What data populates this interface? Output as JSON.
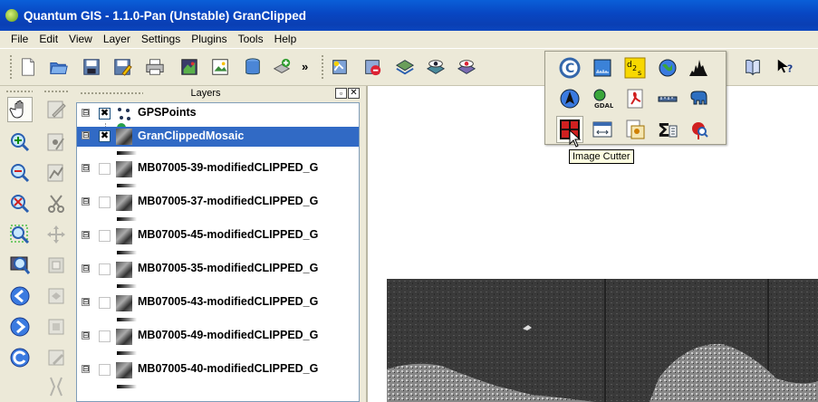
{
  "window": {
    "title": "Quantum GIS - 1.1.0-Pan (Unstable) GranClipped"
  },
  "menu": [
    "File",
    "Edit",
    "View",
    "Layer",
    "Settings",
    "Plugins",
    "Tools",
    "Help"
  ],
  "toolbar": {
    "overflow_label": "»"
  },
  "layers_panel": {
    "title": "Layers",
    "float_label": "▫",
    "close_label": "✕",
    "layers": [
      {
        "name": "GPSPoints",
        "checked": true,
        "check_mark": "✖",
        "expander": "⊟",
        "selected": false
      },
      {
        "name": "GranClippedMosaic",
        "checked": true,
        "check_mark": "✖",
        "expander": "⊟",
        "selected": true
      },
      {
        "name": "MB07005-39-modifiedCLIPPED_G",
        "checked": false,
        "check_mark": "",
        "expander": "⊟",
        "selected": false
      },
      {
        "name": "MB07005-37-modifiedCLIPPED_G",
        "checked": false,
        "check_mark": "",
        "expander": "⊟",
        "selected": false
      },
      {
        "name": "MB07005-45-modifiedCLIPPED_G",
        "checked": false,
        "check_mark": "",
        "expander": "⊟",
        "selected": false
      },
      {
        "name": "MB07005-35-modifiedCLIPPED_G",
        "checked": false,
        "check_mark": "",
        "expander": "⊟",
        "selected": false
      },
      {
        "name": "MB07005-43-modifiedCLIPPED_G",
        "checked": false,
        "check_mark": "",
        "expander": "⊟",
        "selected": false
      },
      {
        "name": "MB07005-49-modifiedCLIPPED_G",
        "checked": false,
        "check_mark": "",
        "expander": "⊟",
        "selected": false
      },
      {
        "name": "MB07005-40-modifiedCLIPPED_G",
        "checked": false,
        "check_mark": "",
        "expander": "⊟",
        "selected": false
      }
    ]
  },
  "plugin_popup": {
    "overflow_label": "»",
    "tooltip": "Image Cutter",
    "icons": [
      "copyright-icon",
      "scale-bar-icon",
      "d2s-icon",
      "globe-icon",
      "histogram-icon",
      "north-arrow-icon",
      "gdal-icon",
      "pdf-icon",
      "measure-icon",
      "elephant-icon",
      "image-cutter-icon",
      "rect-select-icon",
      "raster-info-icon",
      "sum-icon",
      "geocode-icon"
    ],
    "d2s_label": "d2s",
    "gdal_label": "GDAL",
    "sum_label": "Σ"
  },
  "colors": {
    "title_bar": "#0a4fc8",
    "selection": "#316ac5",
    "tooltip_bg": "#ffffe1"
  }
}
